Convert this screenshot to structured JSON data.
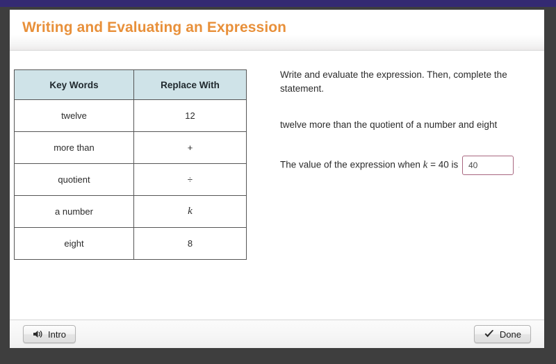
{
  "window": {
    "frame_color": "#3e3e3e",
    "accent_strip_color": "#342a72"
  },
  "header": {
    "title": "Writing and Evaluating an Expression",
    "title_color": "#e8903a"
  },
  "table": {
    "columns": [
      "Key Words",
      "Replace With"
    ],
    "header_fill": "#cfe3e8",
    "rows": [
      {
        "key_word": "twelve",
        "replace_with": "12",
        "italic": false
      },
      {
        "key_word": "more than",
        "replace_with": "+",
        "italic": false
      },
      {
        "key_word": "quotient",
        "replace_with": "÷",
        "italic": false
      },
      {
        "key_word": "a number",
        "replace_with": "k",
        "italic": true
      },
      {
        "key_word": "eight",
        "replace_with": "8",
        "italic": false
      }
    ]
  },
  "prompt": {
    "instruction": "Write and evaluate the expression. Then, complete the statement.",
    "expression_phrase": "twelve more than the quotient of a number and eight",
    "answer_prefix": "The value of the expression when",
    "variable": "k",
    "equals_value": "= 40 is",
    "trailing_period": ".",
    "input": {
      "value": "40",
      "placeholder": "",
      "border_color": "#a8667f"
    }
  },
  "footer": {
    "intro_button": {
      "label": "Intro",
      "icon": "speaker-icon"
    },
    "done_button": {
      "label": "Done",
      "icon": "checkmark-icon"
    }
  }
}
